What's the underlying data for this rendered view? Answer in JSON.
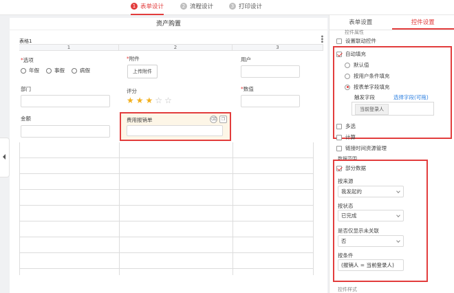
{
  "steps": [
    {
      "num": "1",
      "label": "表单设计"
    },
    {
      "num": "2",
      "label": "流程设计"
    },
    {
      "num": "3",
      "label": "打印设计"
    }
  ],
  "canvas": {
    "title": "资产购置",
    "table_name": "表格1",
    "columns": [
      "1",
      "2",
      "3"
    ],
    "fields": {
      "options": {
        "label": "选项",
        "choices": [
          "年假",
          "事假",
          "病假"
        ]
      },
      "attachment": {
        "label": "附件",
        "button": "上传附件"
      },
      "user": {
        "label": "用户"
      },
      "department": {
        "label": "部门"
      },
      "rating": {
        "label": "评分",
        "value": 3,
        "max": 5
      },
      "number": {
        "label": "数值"
      },
      "amount": {
        "label": "金额"
      },
      "expense": {
        "label": "费用报销单"
      }
    }
  },
  "panel": {
    "tabs": [
      "表单设置",
      "控件设置"
    ],
    "top_cut": "控件属性",
    "linked_control": "设置联动控件",
    "auto_fill": "自动填充",
    "fill_options": [
      "默认值",
      "按用户条件填充",
      "按表单字段填充"
    ],
    "trigger_label": "触发字段",
    "trigger_link": "选择字段(可拖)",
    "trigger_tag": "当前登录人",
    "multi_select": "多选",
    "calculate": "计算",
    "link_resource": "链接时间资源管理",
    "data_range": "数据范围",
    "partial_data": "部分数据",
    "by_source": {
      "label": "按来源",
      "value": "我发起的"
    },
    "by_status": {
      "label": "按状态",
      "value": "已完成"
    },
    "only_unlinked": {
      "label": "是否仅显示未关联",
      "value": "否"
    },
    "by_condition": {
      "label": "按条件",
      "value": "(报销人 = 当前登录人)"
    },
    "bottom_cut": "控件样式"
  }
}
